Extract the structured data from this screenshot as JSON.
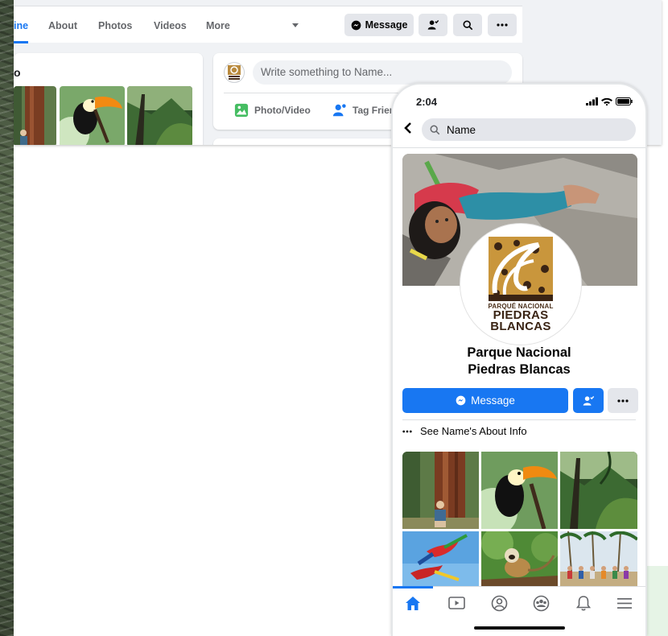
{
  "desktop": {
    "nav_tabs": [
      {
        "label": "ine",
        "active": true
      },
      {
        "label": "About",
        "active": false
      },
      {
        "label": "Photos",
        "active": false
      },
      {
        "label": "Videos",
        "active": false
      },
      {
        "label": "More",
        "active": false
      }
    ],
    "message_button": "Message",
    "photos_card_letter": "o",
    "composer": {
      "placeholder": "Write something to Name...",
      "photo_video": "Photo/Video",
      "tag_friends": "Tag Frien"
    }
  },
  "phone": {
    "status_time": "2:04",
    "search_text": "Name",
    "logo": {
      "line1": "PARQUÉ NACIONAL",
      "line2": "PIEDRAS",
      "line3": "BLANCAS"
    },
    "page_name_line1": "Parque Nacional",
    "page_name_line2": "Piedras Blancas",
    "message_button": "Message",
    "about_info": "See Name's About Info",
    "photo_grid": [
      "sequoia-tree",
      "toucan",
      "rainforest",
      "macaws",
      "squirrel-monkey",
      "group-palms"
    ],
    "tabbar": [
      "home-icon",
      "video-icon",
      "profile-icon",
      "groups-icon",
      "bell-icon",
      "menu-icon"
    ],
    "active_tab": "home-icon"
  },
  "colors": {
    "facebook_blue": "#1877f2",
    "button_gray": "#e4e6eb",
    "page_background": "#f0f2f5",
    "text_secondary": "#65676b"
  }
}
